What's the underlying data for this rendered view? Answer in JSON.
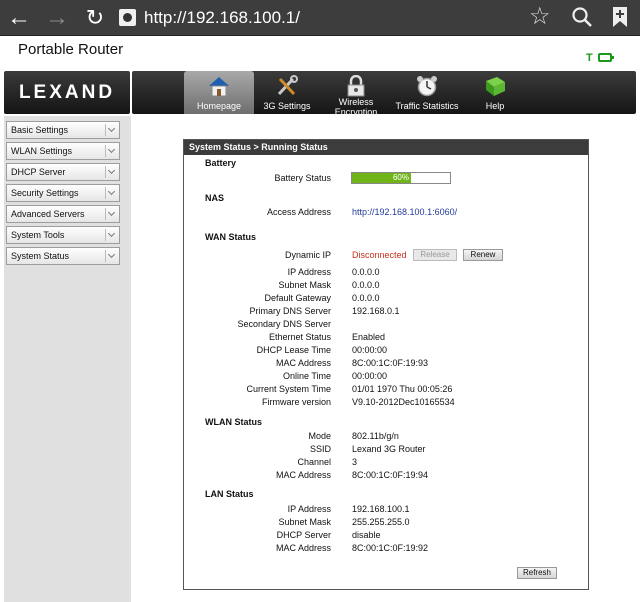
{
  "browser": {
    "url": "http://192.168.100.1/",
    "back_icon": "←",
    "forward_icon": "→",
    "reload_icon": "↻",
    "star_icon": "☆"
  },
  "page": {
    "title": "Portable Router",
    "signal_indicator": "T"
  },
  "logo": {
    "text": "LEXAND"
  },
  "nav": {
    "items": [
      {
        "label": "Homepage",
        "icon": "house-icon",
        "active": true
      },
      {
        "label": "3G Settings",
        "icon": "tools-icon"
      },
      {
        "label": "Wireless Encryption",
        "icon": "lock-icon"
      },
      {
        "label": "Traffic Statistics",
        "icon": "clock-icon"
      },
      {
        "label": "Help",
        "icon": "book-icon"
      }
    ]
  },
  "sidebar": {
    "items": [
      {
        "label": "Basic Settings"
      },
      {
        "label": "WLAN Settings"
      },
      {
        "label": "DHCP Server"
      },
      {
        "label": "Security Settings"
      },
      {
        "label": "Advanced Servers"
      },
      {
        "label": "System Tools"
      },
      {
        "label": "System Status"
      }
    ]
  },
  "status": {
    "header": "System Status > Running Status",
    "battery": {
      "section": "Battery",
      "label": "Battery Status",
      "percent_text": "60%",
      "level": 0.6
    },
    "nas": {
      "section": "NAS",
      "label": "Access Address",
      "value": "http://192.168.100.1:6060/"
    },
    "wan": {
      "section": "WAN Status",
      "dynamic_ip_label": "Dynamic IP",
      "dynamic_ip_value": "Disconnected",
      "release_label": "Release",
      "renew_label": "Renew",
      "rows": [
        {
          "label": "IP Address",
          "value": "0.0.0.0"
        },
        {
          "label": "Subnet Mask",
          "value": "0.0.0.0"
        },
        {
          "label": "Default Gateway",
          "value": "0.0.0.0"
        },
        {
          "label": "Primary DNS Server",
          "value": "192.168.0.1"
        },
        {
          "label": "Secondary DNS Server",
          "value": ""
        },
        {
          "label": "Ethernet Status",
          "value": "Enabled"
        },
        {
          "label": "DHCP Lease Time",
          "value": "00:00:00"
        },
        {
          "label": "MAC Address",
          "value": "8C:00:1C:0F:19:93"
        },
        {
          "label": "Online Time",
          "value": "00:00:00"
        },
        {
          "label": "Current System Time",
          "value": "01/01 1970 Thu 00:05:26"
        },
        {
          "label": "Firmware version",
          "value": "V9.10-2012Dec10165534"
        }
      ]
    },
    "wlan": {
      "section": "WLAN Status",
      "rows": [
        {
          "label": "Mode",
          "value": "802.11b/g/n"
        },
        {
          "label": "SSID",
          "value": "Lexand 3G Router"
        },
        {
          "label": "Channel",
          "value": "3"
        },
        {
          "label": "MAC Address",
          "value": "8C:00:1C:0F:19:94"
        }
      ]
    },
    "lan": {
      "section": "LAN Status",
      "rows": [
        {
          "label": "IP Address",
          "value": "192.168.100.1"
        },
        {
          "label": "Subnet Mask",
          "value": "255.255.255.0"
        },
        {
          "label": "DHCP Server",
          "value": "disable"
        },
        {
          "label": "MAC Address",
          "value": "8C:00:1C:0F:19:92"
        }
      ]
    },
    "refresh_label": "Refresh"
  },
  "colors": {
    "progress_fill": "#6fb51a",
    "disconnected": "#c8301d",
    "link": "#223a9a"
  }
}
